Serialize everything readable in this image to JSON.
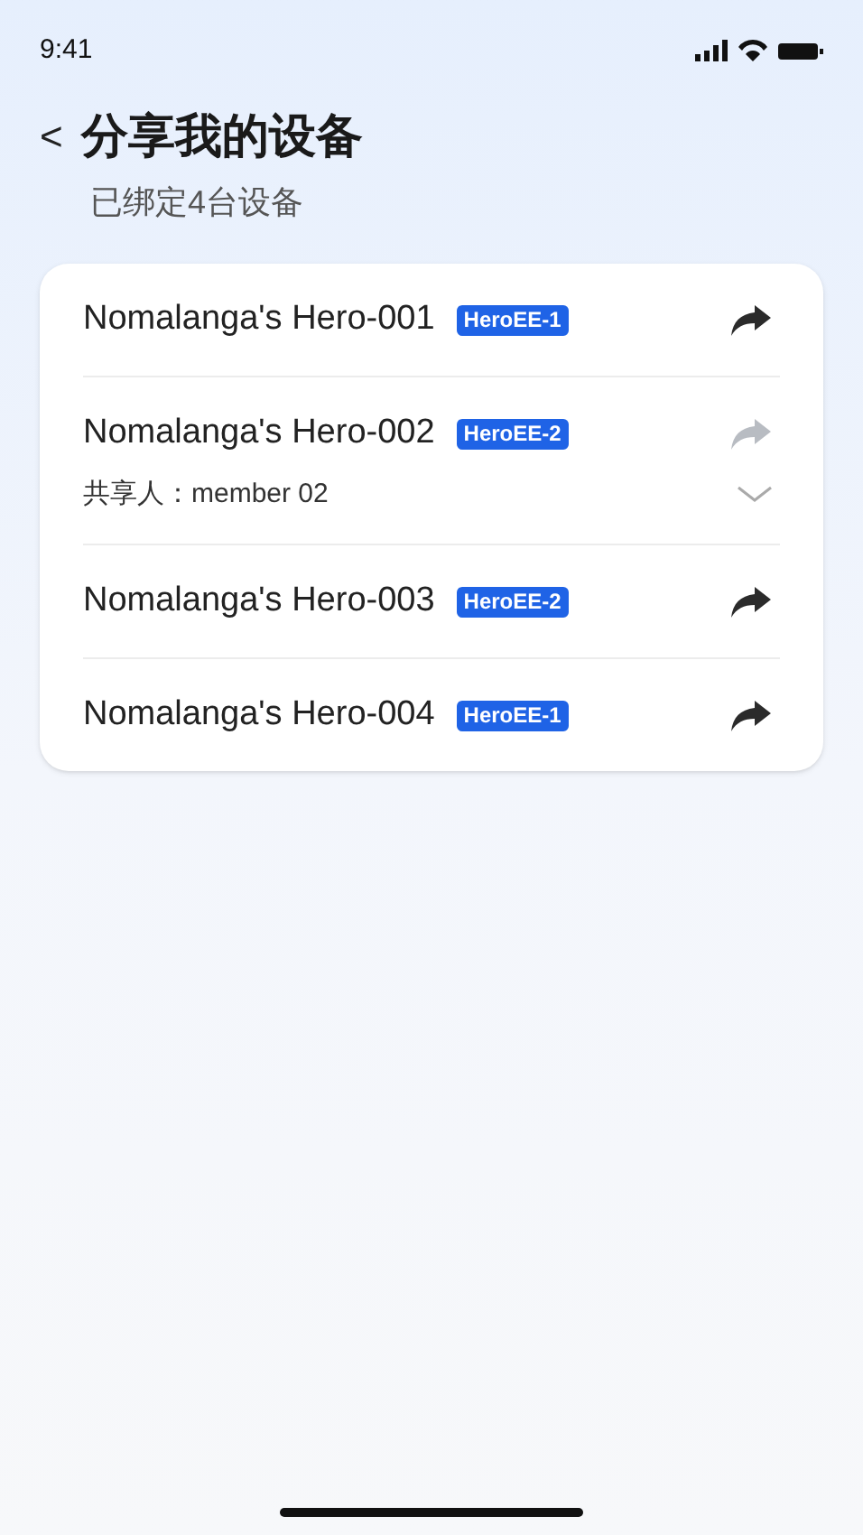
{
  "status_bar": {
    "time": "9:41"
  },
  "header": {
    "back": "<",
    "title": "分享我的设备",
    "subtitle": "已绑定4台设备"
  },
  "devices": [
    {
      "name": "Nomalanga's Hero-001",
      "model": "HeroEE-1",
      "share_disabled": false
    },
    {
      "name": "Nomalanga's Hero-002",
      "model": "HeroEE-2",
      "share_disabled": true,
      "sharer": {
        "label": "共享人：member 02",
        "expanded": false
      }
    },
    {
      "name": "Nomalanga's Hero-003",
      "model": "HeroEE-2",
      "share_disabled": false
    },
    {
      "name": "Nomalanga's Hero-004",
      "model": "HeroEE-1",
      "share_disabled": false
    }
  ]
}
